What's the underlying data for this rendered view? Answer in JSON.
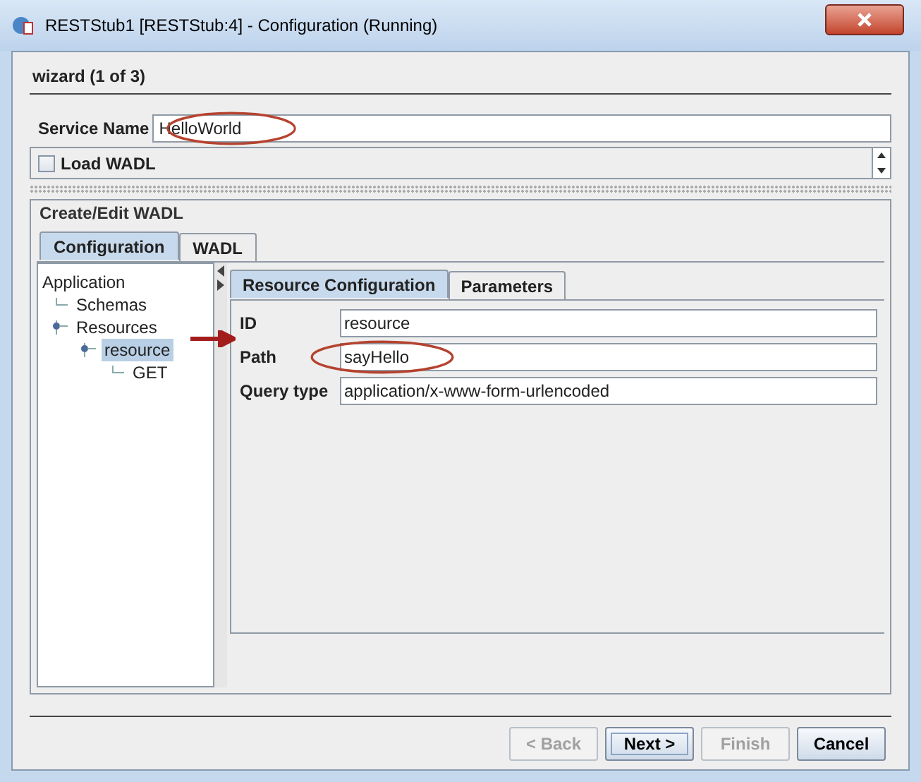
{
  "window": {
    "title": "RESTStub1 [RESTStub:4] - Configuration (Running)"
  },
  "wizard_title": "wizard (1 of 3)",
  "service_name": {
    "label": "Service Name",
    "value": "HelloWorld"
  },
  "load_wadl": {
    "label": "Load WADL",
    "checked": false
  },
  "group": {
    "title": "Create/Edit WADL"
  },
  "tabs": [
    {
      "label": "Configuration",
      "selected": true
    },
    {
      "label": "WADL",
      "selected": false
    }
  ],
  "tree": [
    {
      "label": "Application",
      "selected": false,
      "children": [
        {
          "label": "Schemas",
          "selected": false
        },
        {
          "label": "Resources",
          "selected": false,
          "children": [
            {
              "label": "resource",
              "selected": true,
              "children": [
                {
                  "label": "GET",
                  "selected": false
                }
              ]
            }
          ]
        }
      ]
    }
  ],
  "inner_tabs": [
    {
      "label": "Resource Configuration",
      "selected": true
    },
    {
      "label": "Parameters",
      "selected": false
    }
  ],
  "fields": [
    {
      "label": "ID",
      "value": "resource"
    },
    {
      "label": "Path",
      "value": "sayHello"
    },
    {
      "label": "Query type",
      "value": "application/x-www-form-urlencoded"
    }
  ],
  "buttons": [
    {
      "label": "< Back",
      "disabled": true,
      "default": false
    },
    {
      "label": "Next >",
      "disabled": false,
      "default": true
    },
    {
      "label": "Finish",
      "disabled": true,
      "default": false
    },
    {
      "label": "Cancel",
      "disabled": false,
      "default": false
    }
  ]
}
